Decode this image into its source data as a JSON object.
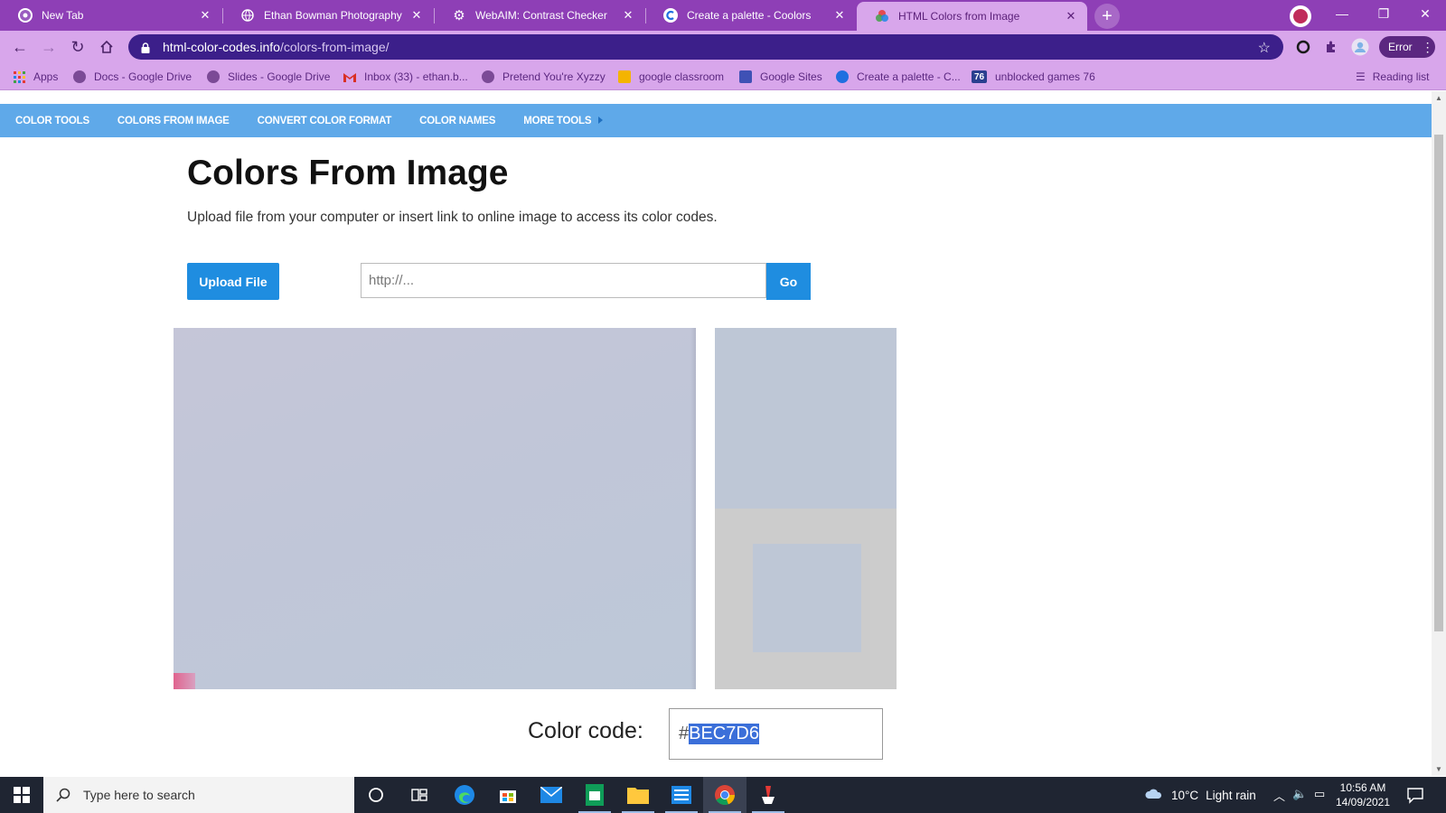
{
  "browser": {
    "tabs": [
      {
        "title": "New Tab",
        "icon": "chrome-icon"
      },
      {
        "title": "Ethan Bowman Photography",
        "icon": "globe-icon"
      },
      {
        "title": "WebAIM: Contrast Checker",
        "icon": "gear-icon"
      },
      {
        "title": "Create a palette - Coolors",
        "icon": "coolors-icon"
      },
      {
        "title": "HTML Colors from Image",
        "icon": "color-wheel-icon"
      }
    ],
    "active_tab": 4,
    "url_host": "html-color-codes.info",
    "url_path": "/colors-from-image/",
    "profile_status": "Error",
    "bookmarks": [
      {
        "label": "Apps",
        "icon": "apps-grid-icon"
      },
      {
        "label": "Docs - Google Drive",
        "icon": "globe-icon"
      },
      {
        "label": "Slides - Google Drive",
        "icon": "globe-icon"
      },
      {
        "label": "Inbox (33) - ethan.b...",
        "icon": "gmail-icon"
      },
      {
        "label": "Pretend You're Xyzzy",
        "icon": "globe-icon"
      },
      {
        "label": "google classroom",
        "icon": "classroom-icon"
      },
      {
        "label": "Google Sites",
        "icon": "sites-icon"
      },
      {
        "label": "Create a palette - C...",
        "icon": "coolors-icon"
      },
      {
        "label": "unblocked games 76",
        "icon": "games76-icon"
      }
    ],
    "bookmark_76_badge": "76",
    "reading_list": "Reading list"
  },
  "site": {
    "nav": [
      "Color Tools",
      "Colors From Image",
      "Convert Color Format",
      "Color Names",
      "More Tools"
    ],
    "title": "Colors From Image",
    "description": "Upload file from your computer or insert link to online image to access its color codes.",
    "upload_label": "Upload File",
    "url_placeholder": "http://...",
    "go_label": "Go",
    "color_code_label": "Color code:",
    "color_code_hash": "#",
    "color_code_value": "BEC7D6",
    "picked_color": "#BEC7D6"
  },
  "taskbar": {
    "search_placeholder": "Type here to search",
    "weather_temp": "10°C",
    "weather_desc": "Light rain",
    "time": "10:56 AM",
    "date": "14/09/2021",
    "apps": [
      "cortana-icon",
      "task-view-icon",
      "edge-icon",
      "store-icon",
      "mail-icon",
      "sheets-icon",
      "file-explorer-icon",
      "word-icon",
      "chrome-icon",
      "paint-icon"
    ]
  },
  "colors": {
    "tabstrip": "#8e3fb6",
    "toolbar": "#d8a6eb",
    "omnibox": "#3c1f8a",
    "site_nav": "#5fa9e9",
    "button_blue": "#1f8de0",
    "swatch_border": "#cccccc"
  }
}
